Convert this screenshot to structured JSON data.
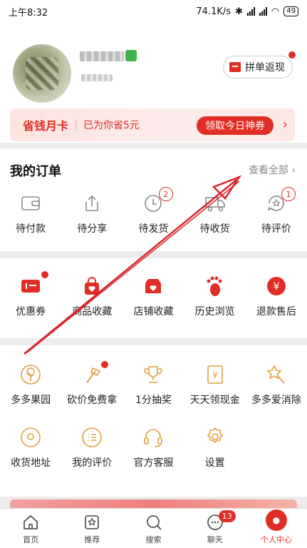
{
  "status_bar": {
    "time": "上午8:32",
    "speed": "74.1K/s",
    "battery": "49"
  },
  "profile": {
    "pin_button_label": "拼单返现"
  },
  "savings_card": {
    "title": "省钱月卡",
    "subtitle": "已为你省5元",
    "button_label": "领取今日神券",
    "arrow": "›"
  },
  "orders": {
    "title": "我的订单",
    "view_all": "查看全部",
    "view_all_arrow": "›",
    "items": [
      {
        "label": "待付款",
        "icon": "wallet-icon",
        "badge": ""
      },
      {
        "label": "待分享",
        "icon": "share-icon",
        "badge": ""
      },
      {
        "label": "待发货",
        "icon": "clock-icon",
        "badge": "2"
      },
      {
        "label": "待收货",
        "icon": "truck-icon",
        "badge": ""
      },
      {
        "label": "待评价",
        "icon": "review-icon",
        "badge": "1"
      }
    ]
  },
  "favorites": {
    "items": [
      {
        "label": "优惠券",
        "icon": "coupon-icon"
      },
      {
        "label": "商品收藏",
        "icon": "bag-heart-icon"
      },
      {
        "label": "店铺收藏",
        "icon": "shop-heart-icon"
      },
      {
        "label": "历史浏览",
        "icon": "footprint-icon"
      },
      {
        "label": "退款售后",
        "icon": "yen-refund-icon"
      }
    ]
  },
  "tools": {
    "row1": [
      {
        "label": "多多果园",
        "icon": "tree-icon"
      },
      {
        "label": "砍价免费拿",
        "icon": "axe-icon"
      },
      {
        "label": "1分抽奖",
        "icon": "trophy-icon"
      },
      {
        "label": "天天领现金",
        "icon": "yen-envelope-icon"
      },
      {
        "label": "多多爱消除",
        "icon": "star-wand-icon"
      }
    ],
    "row2": [
      {
        "label": "收货地址",
        "icon": "location-icon"
      },
      {
        "label": "我的评价",
        "icon": "comment-list-icon"
      },
      {
        "label": "官方客服",
        "icon": "headset-icon"
      },
      {
        "label": "设置",
        "icon": "gear-icon"
      }
    ]
  },
  "tabbar": {
    "items": [
      {
        "label": "首页",
        "icon": "home-icon"
      },
      {
        "label": "推荐",
        "icon": "recommend-icon"
      },
      {
        "label": "搜索",
        "icon": "search-icon"
      },
      {
        "label": "聊天",
        "icon": "chat-icon",
        "badge": "13"
      },
      {
        "label": "个人中心",
        "icon": "person-icon"
      }
    ]
  },
  "colors": {
    "accent": "#e02e24",
    "orange_icon": "#e0a040",
    "gray_icon": "#8a8a8a"
  }
}
